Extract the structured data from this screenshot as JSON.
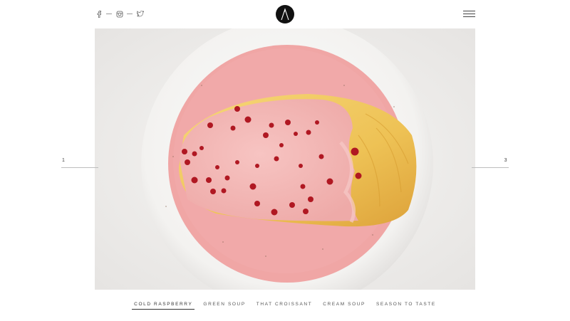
{
  "header": {
    "social": [
      {
        "icon": "facebook-icon"
      },
      {
        "icon": "instagram-icon"
      },
      {
        "icon": "twitter-icon"
      }
    ],
    "logo_glyph": "Λ",
    "menu_icon": "hamburger-menu-icon"
  },
  "pager": {
    "prev": "1",
    "next": "3"
  },
  "nav": {
    "items": [
      "COLD RASPBERRY",
      "GREEN SOUP",
      "THAT CROISSANT",
      "CREAM SOUP",
      "SEASON TO TASTE"
    ],
    "active_index": 0
  },
  "colors": {
    "background": "#ffffff",
    "plate": "#f3f2f0",
    "sauce": "#f0a8a8",
    "salmon": "#eec255",
    "berry": "#b01822"
  }
}
